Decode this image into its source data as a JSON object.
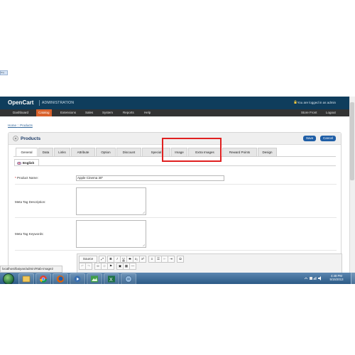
{
  "broken_image": {
    "label": "img"
  },
  "header": {
    "brand": "OpenCart",
    "subtitle": "ADMINISTRATION",
    "logged_in": "You are logged in as admin"
  },
  "menu": {
    "items": [
      "Dashboard",
      "Catalog",
      "Extensions",
      "Sales",
      "System",
      "Reports",
      "Help"
    ],
    "active": "Catalog",
    "right": [
      "Store Front",
      "Logout"
    ]
  },
  "breadcrumb": {
    "home": "Home",
    "sep": "::",
    "current": "Products"
  },
  "panel": {
    "title": "Products",
    "save": "Save",
    "cancel": "Cancel"
  },
  "tabs": [
    "General",
    "Data",
    "Links",
    "Attribute",
    "Option",
    "Discount",
    "Special",
    "Image",
    "Extra Images",
    "Reward Points",
    "Design"
  ],
  "active_tab": "General",
  "language_tab": "English",
  "form": {
    "product_name_label": "Product Name:",
    "product_name_value": "Apple Cinema 30\"",
    "meta_desc_label": "Meta Tag Description:",
    "meta_keywords_label": "Meta Tag Keywords:"
  },
  "editor": {
    "source_label": "Source",
    "row1": [
      "B",
      "I",
      "U",
      "S",
      "x₂",
      "x²"
    ],
    "omega": "Ω"
  },
  "status_url": "localhost/baiyan/admin/#tab-image2",
  "clock": {
    "time": "4:48 PM",
    "date": "5/15/2013"
  },
  "colors": {
    "header": "#0f3d5c",
    "menubar": "#333333",
    "active_menu": "#d8602a",
    "button": "#1f5ea6",
    "highlight": "#e02020"
  }
}
